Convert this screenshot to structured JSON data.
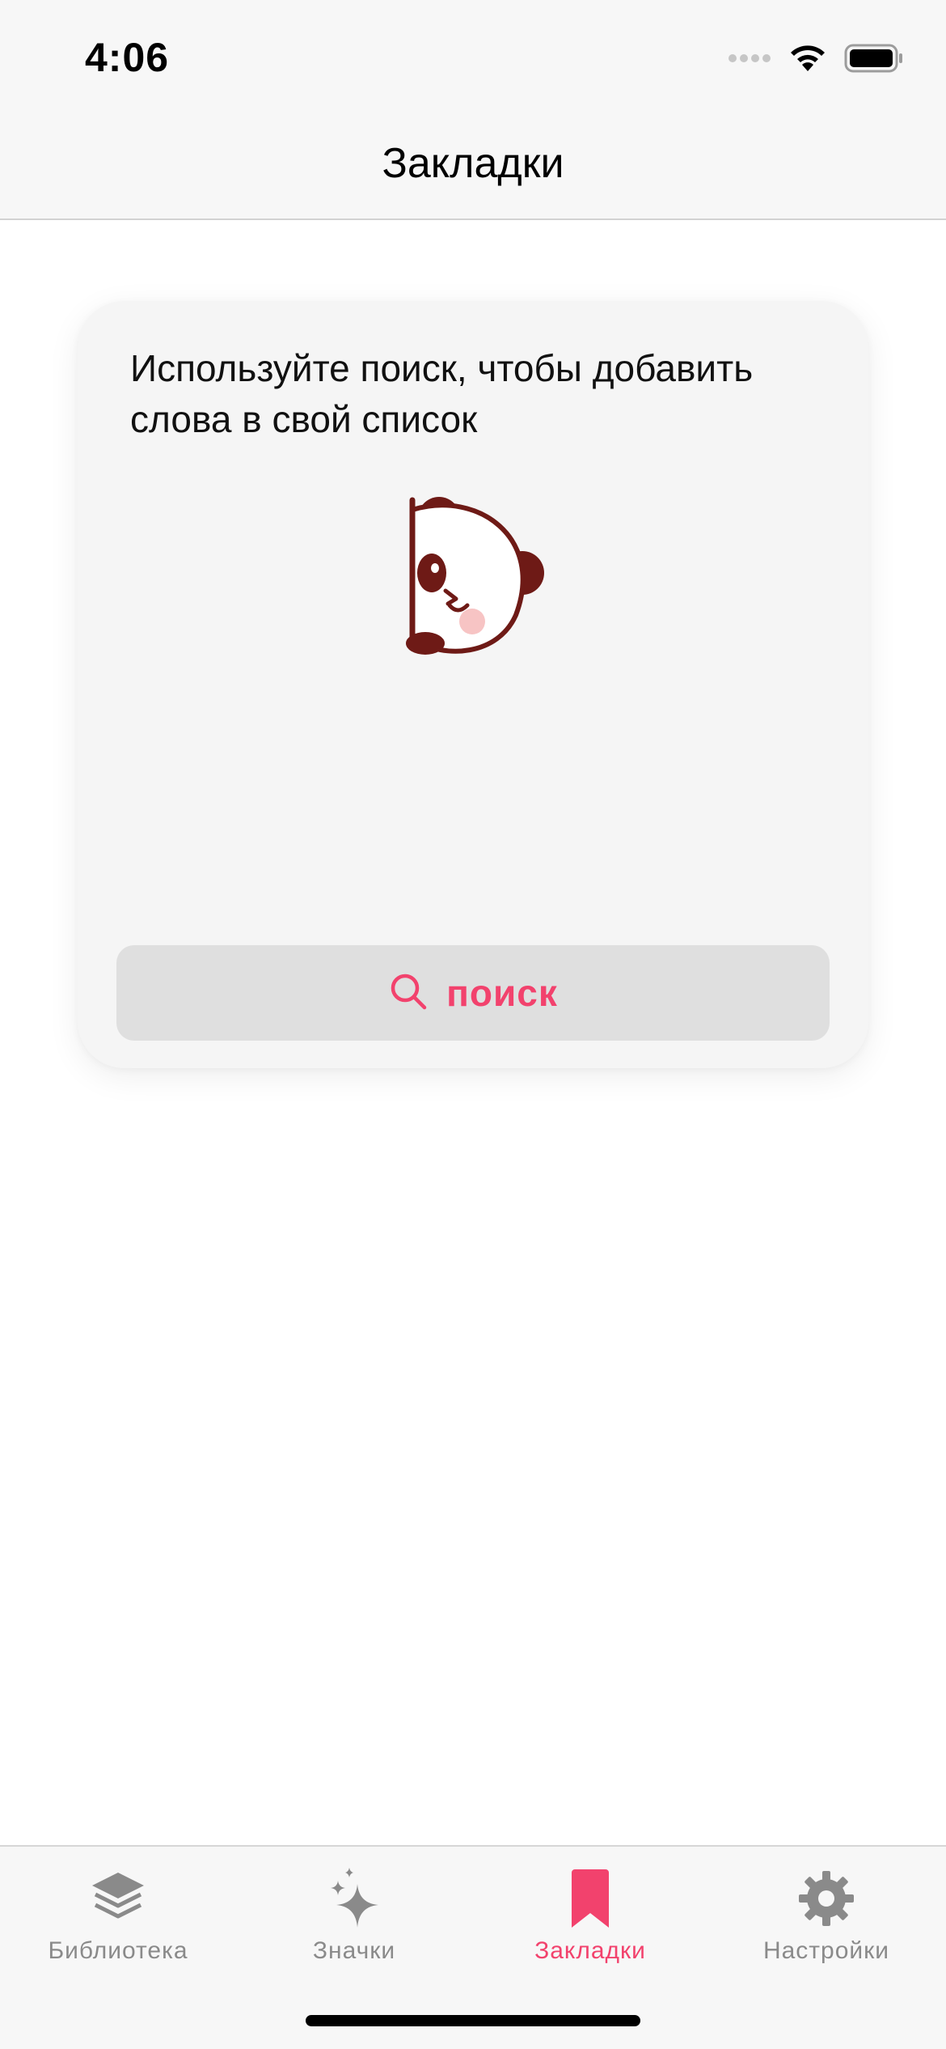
{
  "status_bar": {
    "time": "4:06"
  },
  "nav": {
    "title": "Закладки"
  },
  "card": {
    "message": "Используйте поиск, чтобы добавить слова в свой список",
    "search_button_label": "поиск"
  },
  "tabs": [
    {
      "label": "Библиотека",
      "icon": "layers-icon",
      "active": false
    },
    {
      "label": "Значки",
      "icon": "sparkles-icon",
      "active": false
    },
    {
      "label": "Закладки",
      "icon": "bookmark-icon",
      "active": true
    },
    {
      "label": "Настройки",
      "icon": "gear-icon",
      "active": false
    }
  ],
  "colors": {
    "accent": "#f2426d",
    "inactive": "#8a8a8a",
    "panda_brown": "#6e1a16",
    "panda_blush": "#f7c4c4"
  }
}
